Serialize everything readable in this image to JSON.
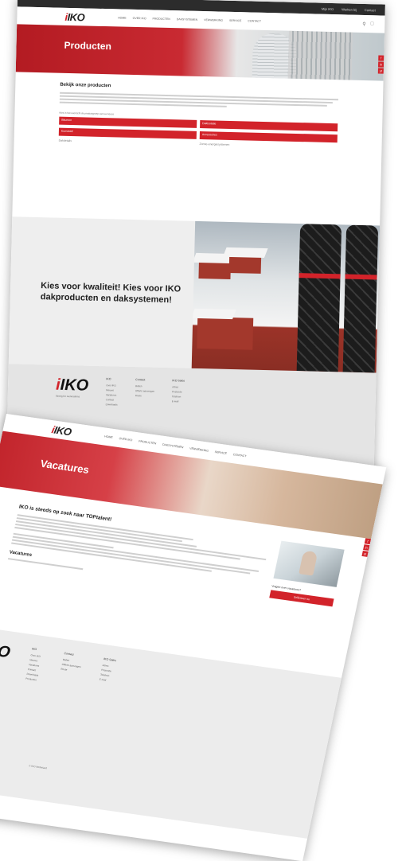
{
  "brand": {
    "logo": "IKO",
    "tagline": "Strong for Generations",
    "accent": "#d2232a"
  },
  "topbar": {
    "links": [
      "Mijn IKO",
      "Werken bij",
      "Contact"
    ]
  },
  "nav": {
    "items": [
      "HOME",
      "OVER IKO",
      "PRODUCTEN",
      "DAKSYSTEMEN",
      "VERWERKING",
      "SERVICE",
      "CONTACT"
    ]
  },
  "social": [
    "f",
    "in",
    "yt"
  ],
  "page1": {
    "hero_title": "Producten",
    "heading": "Bekijk onze producten",
    "link_intro": "Kies in het overzicht de productgroep van uw keuze",
    "buttons": [
      "Bitumen",
      "Dakisolatie",
      "Kunststof",
      "Accessoires"
    ],
    "links": [
      "Dakdetails",
      "Zonne-energiesystemen"
    ],
    "promo": "Kies voor kwaliteit! Kies voor IKO dakproducten en daksystemen!"
  },
  "footer": {
    "col1_head": "IKO",
    "col1": [
      "Over IKO",
      "Nieuws",
      "Vacatures",
      "Contact",
      "Downloads",
      "Producten"
    ],
    "col2_head": "Contact",
    "col2": [
      "Bellen",
      "Offerte aanvragen",
      "Route"
    ],
    "col3_head": "IKO Sales",
    "col3": [
      "Adres",
      "Postcode",
      "Telefoon",
      "E-mail"
    ]
  },
  "page2": {
    "hero_title": "Vacatures",
    "heading": "IKO is steeds op zoek naar TOPtalent!",
    "subheading": "Vacatures",
    "side_question": "Vragen over vacatures?",
    "side_button": "Solliciteer nu",
    "copyright": "© IKO Nederland"
  }
}
